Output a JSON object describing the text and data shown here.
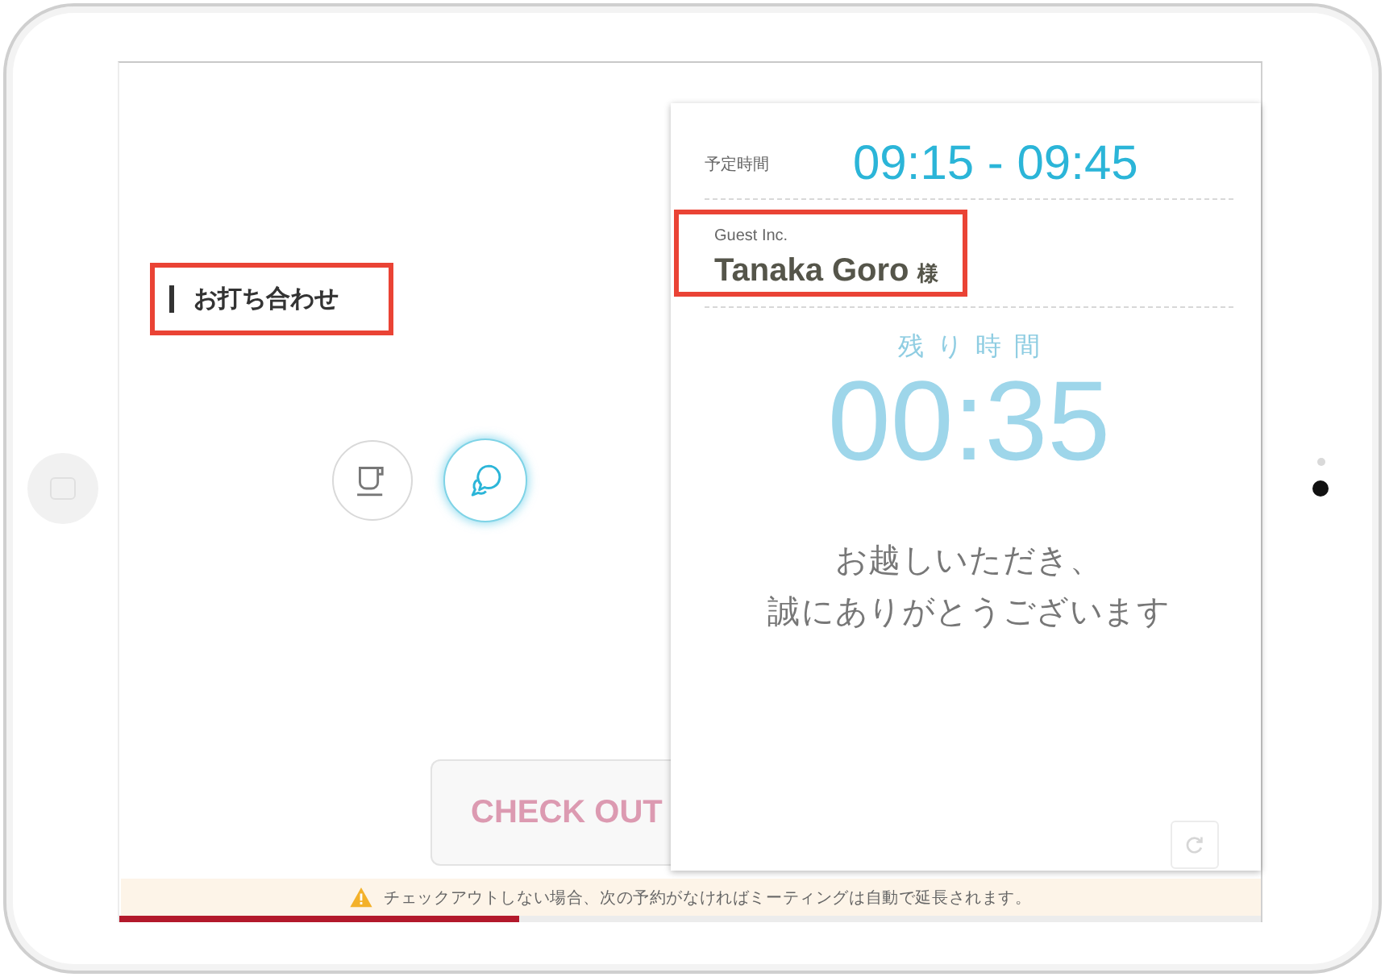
{
  "screen": {
    "meeting": {
      "title": "お打ち合わせ",
      "highlighted": true
    },
    "modes": [
      {
        "kind": "cup",
        "selected": false
      },
      {
        "kind": "chat",
        "selected": true
      }
    ],
    "checkout_button": {
      "label": "CHECK OUT",
      "disabled": true
    },
    "notice": {
      "text": "チェックアウトしない場合、次の予約がなければミーティングは自動で延長されます。"
    },
    "progress": {
      "level": 0.35
    }
  },
  "panel": {
    "schedule_label": "予定時間",
    "schedule_time": "09:15 - 09:45",
    "guest": {
      "company": "Guest Inc.",
      "name": "Tanaka Goro",
      "honorific": "様",
      "highlighted": true
    },
    "remaining_label": "残り時間",
    "remaining_time": "00:35",
    "message_lines": [
      "お越しいただき、",
      "誠にありがとうございます"
    ]
  }
}
